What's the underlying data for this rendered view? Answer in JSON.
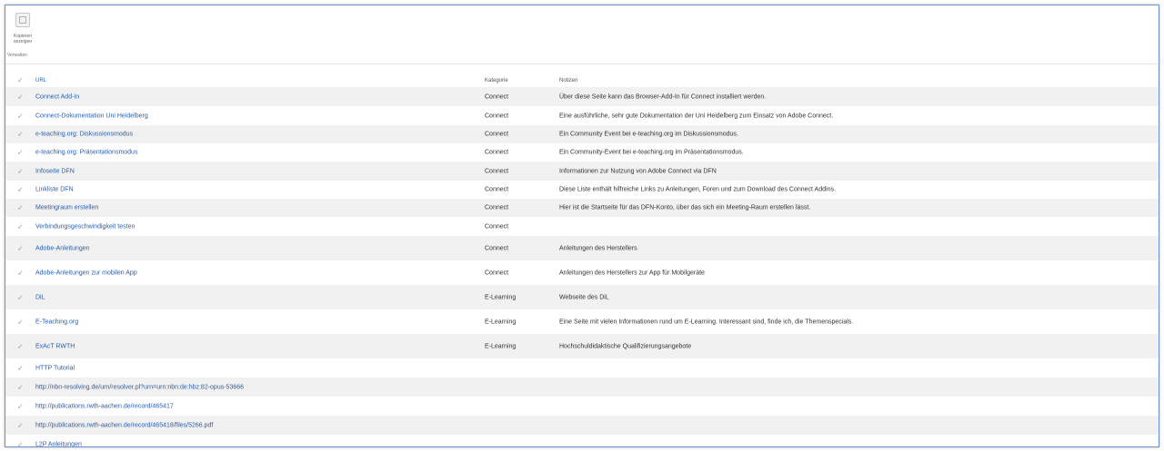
{
  "ribbon": {
    "button_label": "Kopieren\nanzeigen",
    "group_label": "Verwalten"
  },
  "columns": {
    "url": "URL",
    "category": "Kategorie",
    "note": "Notizen"
  },
  "rows": [
    {
      "url": "Connect Add-In",
      "category": "Connect",
      "note": "Über diese Seite kann das Browser-Add-In für Connect installiert werden.",
      "h": 21
    },
    {
      "url": "Connect-Dokumentation Uni Heidelberg",
      "category": "Connect",
      "note": "Eine ausführliche, sehr gute Dokumentation der Uni Heidelberg zum Einsatz von Adobe Connect.",
      "h": 21
    },
    {
      "url": "e-teaching.org: Diskussionsmodus",
      "category": "Connect",
      "note": "Ein Community Event bei e-teaching.org im Diskussionsmodus.",
      "h": 20
    },
    {
      "url": "e-teaching.org: Präsentationsmodus",
      "category": "Connect",
      "note": "Ein Community-Event bei e-teaching.org im Präsentationsmodus.",
      "h": 20
    },
    {
      "url": "Infoseite DFN",
      "category": "Connect",
      "note": "Informationen zur Nutzung von Adobe Connect via DFN",
      "h": 21
    },
    {
      "url": "Linkliste DFN",
      "category": "Connect",
      "note": "Diese Liste enthält hilfreiche Links zu Anleitungen, Foren und zum Download des Connect Addins.",
      "h": 20
    },
    {
      "url": "Meetingraum erstellen",
      "category": "Connect",
      "note": "Hier ist die Startseite für das DFN-Konto, über das sich ein Meeting-Raum erstellen lässt.",
      "h": 20
    },
    {
      "url": "Verbindungsgeschwindigkeit testen",
      "category": "Connect",
      "note": "",
      "h": 21
    },
    {
      "url": "Adobe-Anleitungen",
      "category": "Connect",
      "note": "Anleitungen des Herstellers",
      "h": 27
    },
    {
      "url": "Adobe-Anleitungen zur mobilen App",
      "category": "Connect",
      "note": "Anleitungen des Herstellers zur App für Mobilgeräte",
      "h": 27
    },
    {
      "url": "DiL",
      "category": "E-Learning",
      "note": "Webseite des DiL",
      "h": 27
    },
    {
      "url": "E-Teaching.org",
      "category": "E-Learning",
      "note": "Eine Seite mit vielen Informationen rund um E-Learning. Interessant sind, finde ich, die Themenspecials.",
      "h": 27
    },
    {
      "url": "ExAcT RWTH",
      "category": "E-Learning",
      "note": "Hochschuldidaktische Qualifizierungsangebote",
      "h": 27
    },
    {
      "url": "HTTP Tutorial",
      "category": "",
      "note": "",
      "h": 21
    },
    {
      "url": "http://nbn-resolving.de/urn/resolver.pl?urn=urn:nbn:de:hbz:82-opus-53666",
      "category": "",
      "note": "",
      "h": 21
    },
    {
      "url": "http://publications.rwth-aachen.de/record/465417",
      "category": "",
      "note": "",
      "h": 21
    },
    {
      "url": "http://publications.rwth-aachen.de/record/465418/files/5266.pdf",
      "category": "",
      "note": "",
      "h": 21
    },
    {
      "url": "L2P Anleitungen",
      "category": "",
      "note": "",
      "h": 21
    }
  ]
}
